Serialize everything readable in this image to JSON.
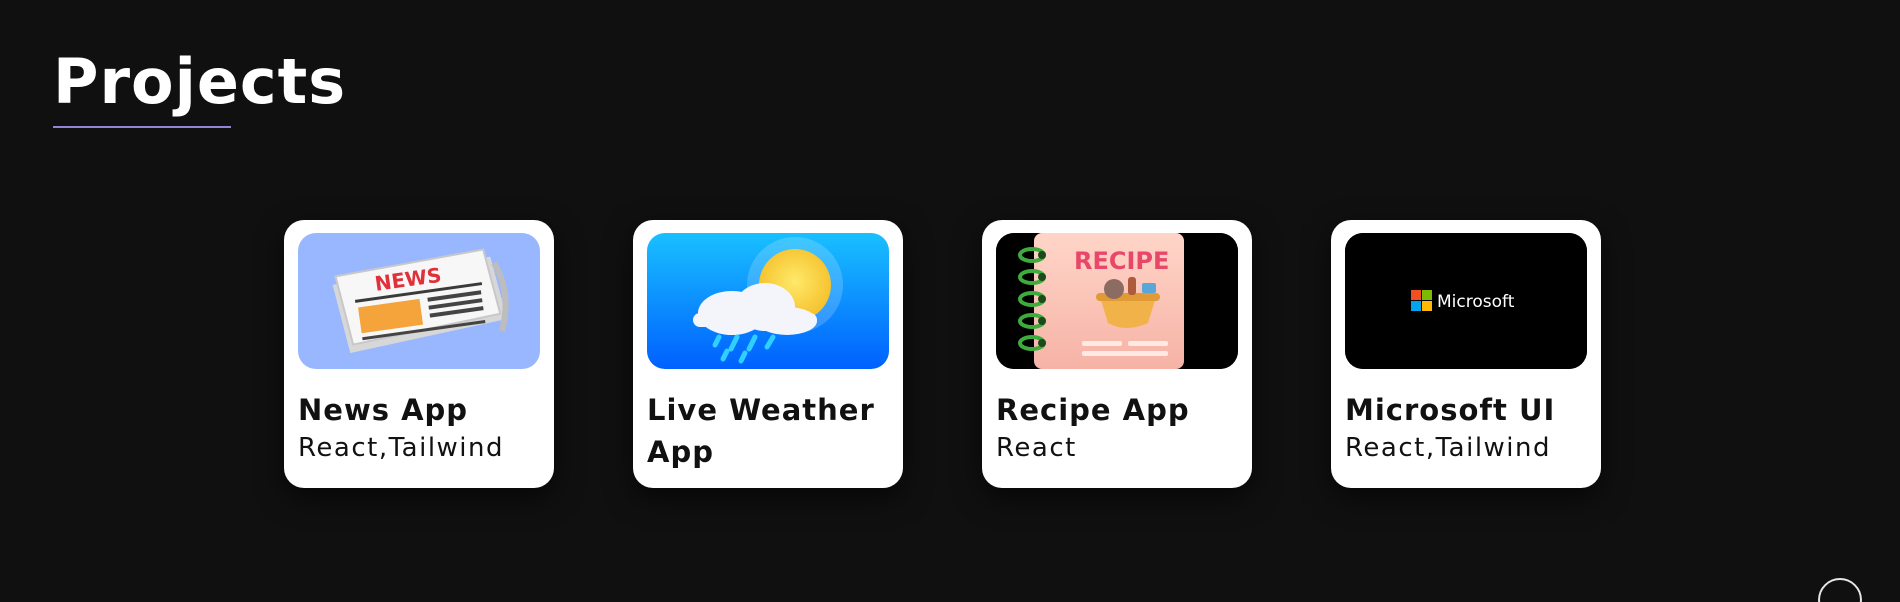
{
  "section": {
    "title": "Projects"
  },
  "projects": [
    {
      "title": "News App",
      "tech": "React,Tailwind",
      "image_icon": "newspaper-icon",
      "thumb_text": "NEWS",
      "thumb_bg": "#99b7ff"
    },
    {
      "title": "Live Weather App",
      "tech": "",
      "image_icon": "weather-cloud-sun-icon",
      "thumb_bg": "#0a7dff"
    },
    {
      "title": "Recipe App",
      "tech": "React",
      "image_icon": "recipe-book-icon",
      "thumb_text": "RECIPE",
      "thumb_bg": "#000000"
    },
    {
      "title": "Microsoft UI",
      "tech": "React,Tailwind",
      "image_icon": "microsoft-logo-icon",
      "thumb_text": "Microsoft",
      "thumb_bg": "#000000"
    }
  ],
  "colors": {
    "background": "#101010",
    "accent_underline": "#8f86d8",
    "card": "#ffffff"
  }
}
